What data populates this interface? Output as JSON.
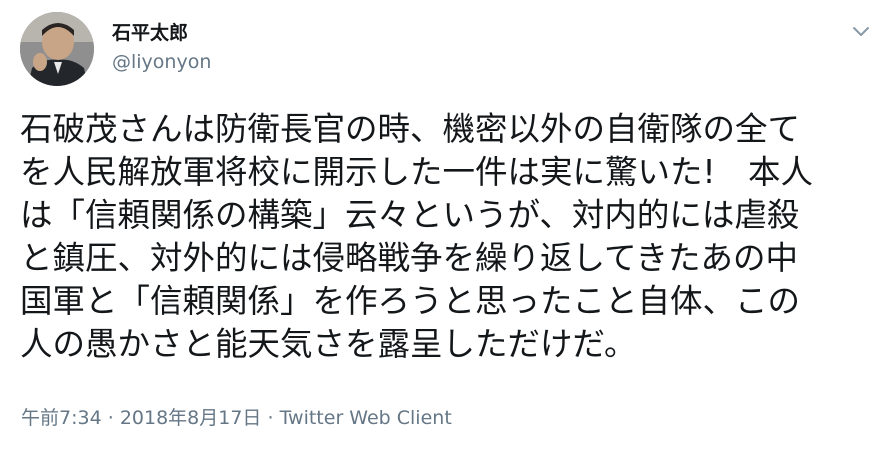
{
  "tweet": {
    "display_name": "石平太郎",
    "handle": "@liyonyon",
    "text": "石破茂さんは防衛長官の時、機密以外の自衛隊の全て\nを人民解放軍将校に開示した一件は実に驚いた!　本人\nは「信頼関係の構築」云々というが、対内的には虐殺\nと鎮圧、対外的には侵略戦争を繰り返してきたあの中\n国軍と「信頼関係」を作ろうと思ったこと自体、この\n人の愚かさと能天気さを露呈しただけだ。",
    "time": "午前7:34",
    "separator": "·",
    "date": "2018年8月17日",
    "source": "Twitter Web Client",
    "menu_icon": "chevron-down-icon"
  },
  "colors": {
    "text_primary": "#14171a",
    "text_secondary": "#657786",
    "background": "#ffffff"
  }
}
